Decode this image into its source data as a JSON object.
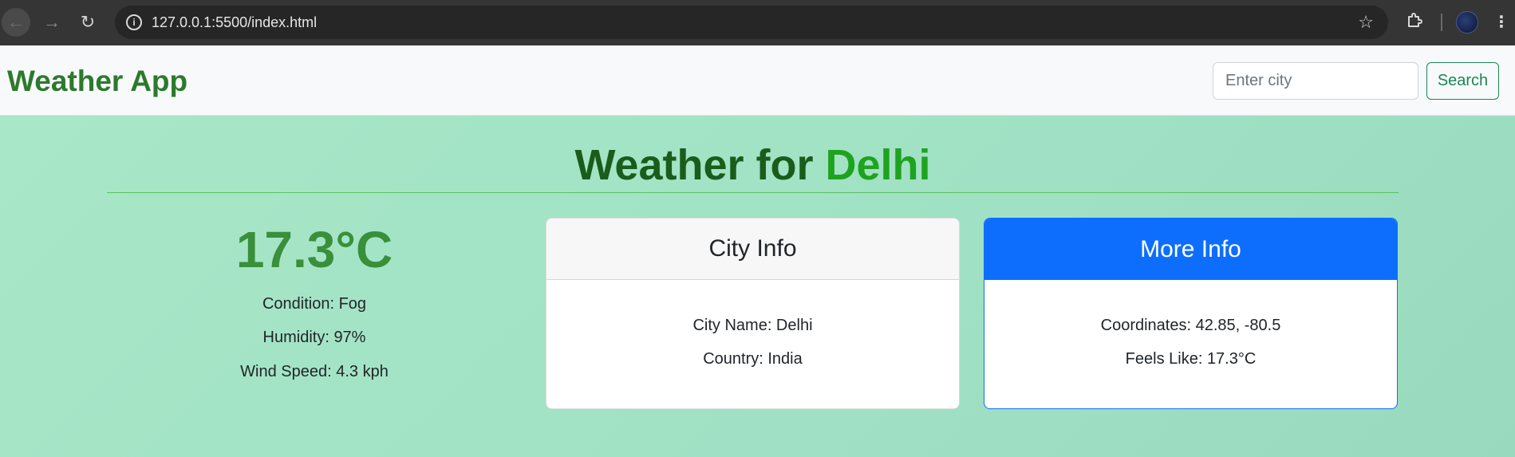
{
  "browser": {
    "url": "127.0.0.1:5500/index.html",
    "back_icon": "arrow-left-icon",
    "forward_icon": "arrow-right-icon",
    "reload_icon": "reload-icon",
    "info_icon": "info-icon",
    "star_icon": "star-icon",
    "extensions_icon": "puzzle-icon",
    "menu_icon": "kebab-menu-icon"
  },
  "navbar": {
    "brand": "Weather App",
    "search_placeholder": "Enter city",
    "search_value": "",
    "search_button": "Search"
  },
  "weather": {
    "heading_prefix": "Weather for",
    "city": "Delhi",
    "temperature": "17.3°C",
    "condition": "Condition: Fog",
    "humidity": "Humidity: 97%",
    "wind": "Wind Speed: 4.3 kph"
  },
  "city_info": {
    "title": "City Info",
    "name": "City Name: Delhi",
    "country": "Country: India"
  },
  "more_info": {
    "title": "More Info",
    "coordinates": "Coordinates: 42.85, -80.5",
    "feels_like": "Feels Like: 17.3°C"
  },
  "colors": {
    "brand_green": "#2c7a2c",
    "heading_green": "#1a5c1a",
    "city_green": "#1ea31e",
    "temp_green": "#3a8f3a",
    "primary_blue": "#0d6efd",
    "background_mint": "#a3e4c4"
  }
}
